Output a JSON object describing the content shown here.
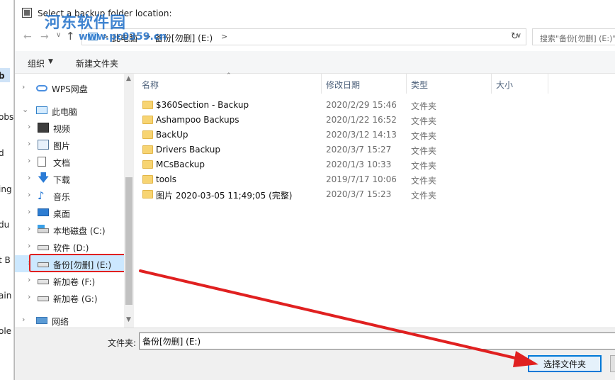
{
  "background_window": {
    "fragments": [
      "b",
      "obs",
      "d",
      "ing",
      "du",
      "t B",
      "ain",
      "ole"
    ]
  },
  "dialog": {
    "title": "Select a backup folder location:",
    "watermark": {
      "text": "河东软件园",
      "url": "www.pc0359.cn"
    }
  },
  "address_bar": {
    "root_label": "此电脑",
    "current_label": "备份[勿删] (E:)",
    "separator": ">"
  },
  "search": {
    "placeholder": "搜索\"备份[勿删] (E:)\""
  },
  "toolbar": {
    "organize_label": "组织",
    "new_folder_label": "新建文件夹"
  },
  "tree": {
    "items": [
      {
        "label": "WPS网盘",
        "icon": "cloud-icon"
      },
      {
        "label": "此电脑",
        "icon": "computer-icon"
      },
      {
        "label": "视频",
        "icon": "video-icon"
      },
      {
        "label": "图片",
        "icon": "picture-icon"
      },
      {
        "label": "文档",
        "icon": "document-icon"
      },
      {
        "label": "下载",
        "icon": "download-icon"
      },
      {
        "label": "音乐",
        "icon": "music-icon"
      },
      {
        "label": "桌面",
        "icon": "desktop-icon"
      },
      {
        "label": "本地磁盘 (C:)",
        "icon": "system-drive-icon"
      },
      {
        "label": "软件 (D:)",
        "icon": "drive-icon"
      },
      {
        "label": "备份[勿删] (E:)",
        "icon": "drive-icon",
        "selected": true
      },
      {
        "label": "新加卷 (F:)",
        "icon": "drive-icon"
      },
      {
        "label": "新加卷 (G:)",
        "icon": "drive-icon"
      },
      {
        "label": "网络",
        "icon": "network-icon"
      }
    ]
  },
  "list": {
    "columns": [
      "名称",
      "修改日期",
      "类型",
      "大小"
    ],
    "rows": [
      {
        "name": "$360Section - Backup",
        "date": "2020/2/29 15:46",
        "type": "文件夹"
      },
      {
        "name": "Ashampoo Backups",
        "date": "2020/1/22 16:52",
        "type": "文件夹"
      },
      {
        "name": "BackUp",
        "date": "2020/3/12 14:13",
        "type": "文件夹"
      },
      {
        "name": "Drivers Backup",
        "date": "2020/3/7 15:27",
        "type": "文件夹"
      },
      {
        "name": "MCsBackup",
        "date": "2020/1/3 10:33",
        "type": "文件夹"
      },
      {
        "name": "tools",
        "date": "2019/7/17 10:06",
        "type": "文件夹"
      },
      {
        "name": "图片 2020-03-05 11;49;05 (完整)",
        "date": "2020/3/7 15:23",
        "type": "文件夹"
      }
    ]
  },
  "footer": {
    "folder_label": "文件夹:",
    "folder_value": "备份[勿删] (E:)",
    "select_button": "选择文件夹"
  },
  "colors": {
    "annotation_red": "#e02020",
    "selection_blue": "#cce8ff",
    "folder_yellow": "#f7d472",
    "button_border": "#0078d7"
  }
}
